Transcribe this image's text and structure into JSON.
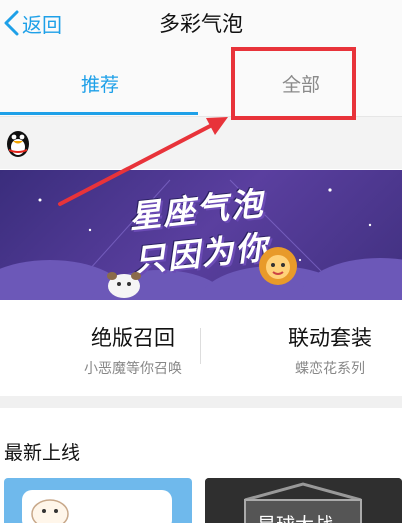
{
  "nav": {
    "back_label": "返回",
    "title": "多彩气泡"
  },
  "tabs": [
    {
      "label": "推荐",
      "active": true
    },
    {
      "label": "全部",
      "active": false
    }
  ],
  "banner": {
    "text_line1": "星座气泡",
    "text_line2": "只因为你"
  },
  "features": [
    {
      "title": "绝版召回",
      "subtitle": "小恶魔等你召唤"
    },
    {
      "title": "联动套装",
      "subtitle": "蝶恋花系列"
    }
  ],
  "section": {
    "latest_title": "最新上线"
  },
  "thumbs": [
    {
      "label": ""
    },
    {
      "label": "星球大战"
    }
  ],
  "colors": {
    "accent": "#1ea0e8",
    "highlight": "#e8333a",
    "banner": "#4a3a8f"
  },
  "icons": [
    "chevron-left-icon",
    "qq-penguin-icon"
  ]
}
